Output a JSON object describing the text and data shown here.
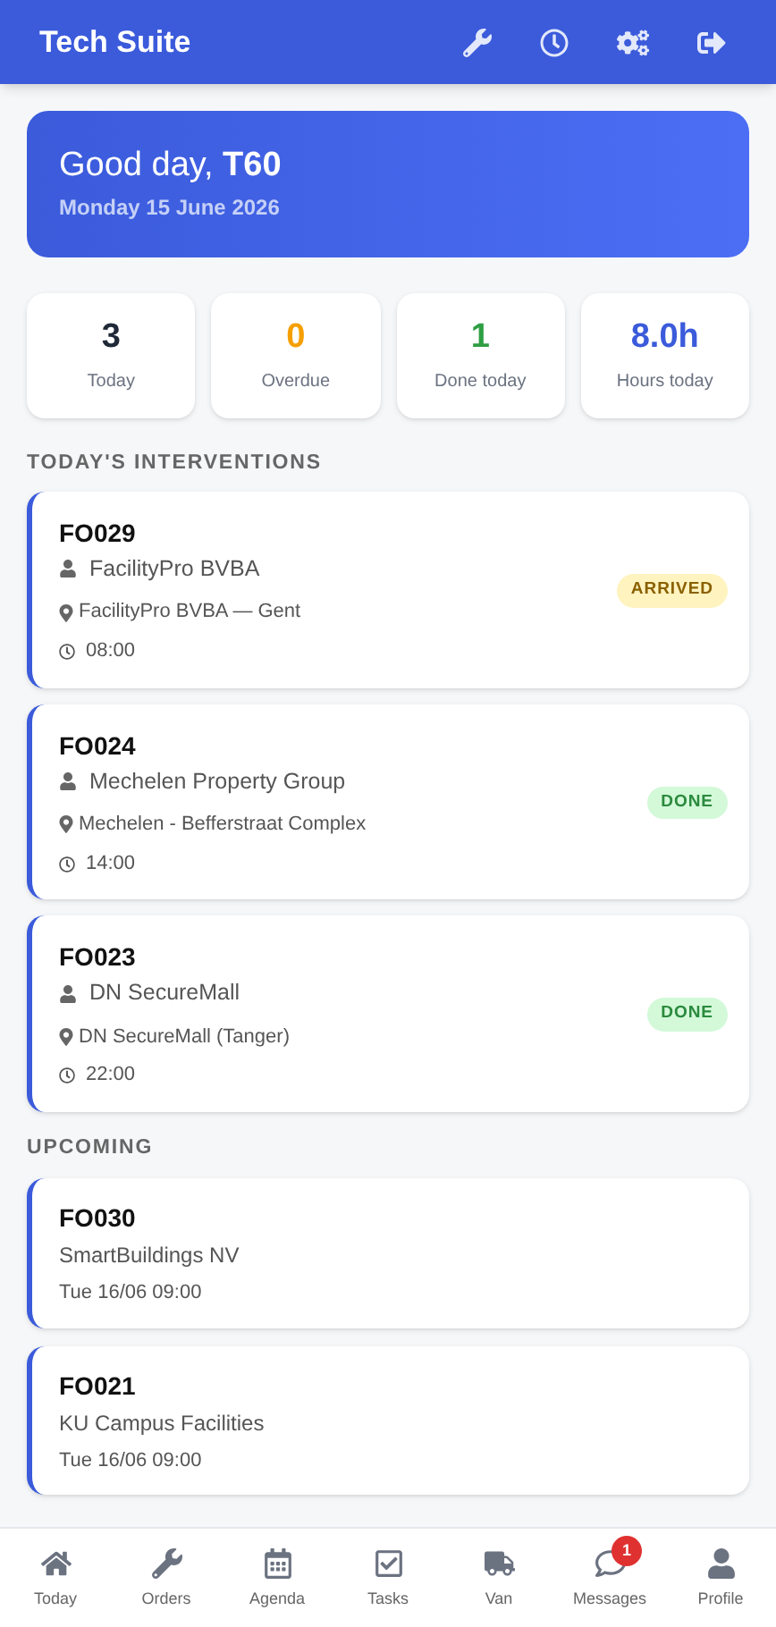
{
  "header": {
    "title": "Tech Suite"
  },
  "greeting": {
    "text": "Good day, **T60**",
    "date": "Monday 15 June 2026"
  },
  "stats": [
    {
      "value": "3",
      "label": "Today",
      "color": "#1f2937"
    },
    {
      "value": "0",
      "label": "Overdue",
      "color": "#f59f00"
    },
    {
      "value": "1",
      "label": "Done today",
      "color": "#2f9e44"
    },
    {
      "value": "8.0h",
      "label": "Hours today",
      "color": "#3b5bdb"
    }
  ],
  "interventions": {
    "heading": "TODAY'S INTERVENTIONS",
    "items": [
      {
        "code": "FO029",
        "client": "FacilityPro BVBA",
        "location": "FacilityPro BVBA — Gent",
        "time": "08:00",
        "status": {
          "label": "ARRIVED",
          "kind": "arrived"
        }
      },
      {
        "code": "FO024",
        "client": "Mechelen Property Group",
        "location": "Mechelen - Befferstraat Complex",
        "time": "14:00",
        "status": {
          "label": "DONE",
          "kind": "done"
        }
      },
      {
        "code": "FO023",
        "client": "DN SecureMall",
        "location": "DN SecureMall (Tanger)",
        "time": "22:00",
        "status": {
          "label": "DONE",
          "kind": "done"
        }
      }
    ]
  },
  "upcoming": {
    "heading": "UPCOMING",
    "items": [
      {
        "code": "FO030",
        "client": "SmartBuildings NV",
        "when": "Tue 16/06 09:00"
      },
      {
        "code": "FO021",
        "client": "KU Campus Facilities",
        "when": "Tue 16/06 09:00"
      }
    ]
  },
  "nav": [
    {
      "kind": "home",
      "label": "Today"
    },
    {
      "kind": "orders",
      "label": "Orders"
    },
    {
      "kind": "agenda",
      "label": "Agenda"
    },
    {
      "kind": "tasks",
      "label": "Tasks"
    },
    {
      "kind": "van",
      "label": "Van"
    },
    {
      "kind": "messages",
      "label": "Messages",
      "badge": "1"
    },
    {
      "kind": "profile",
      "label": "Profile"
    }
  ]
}
